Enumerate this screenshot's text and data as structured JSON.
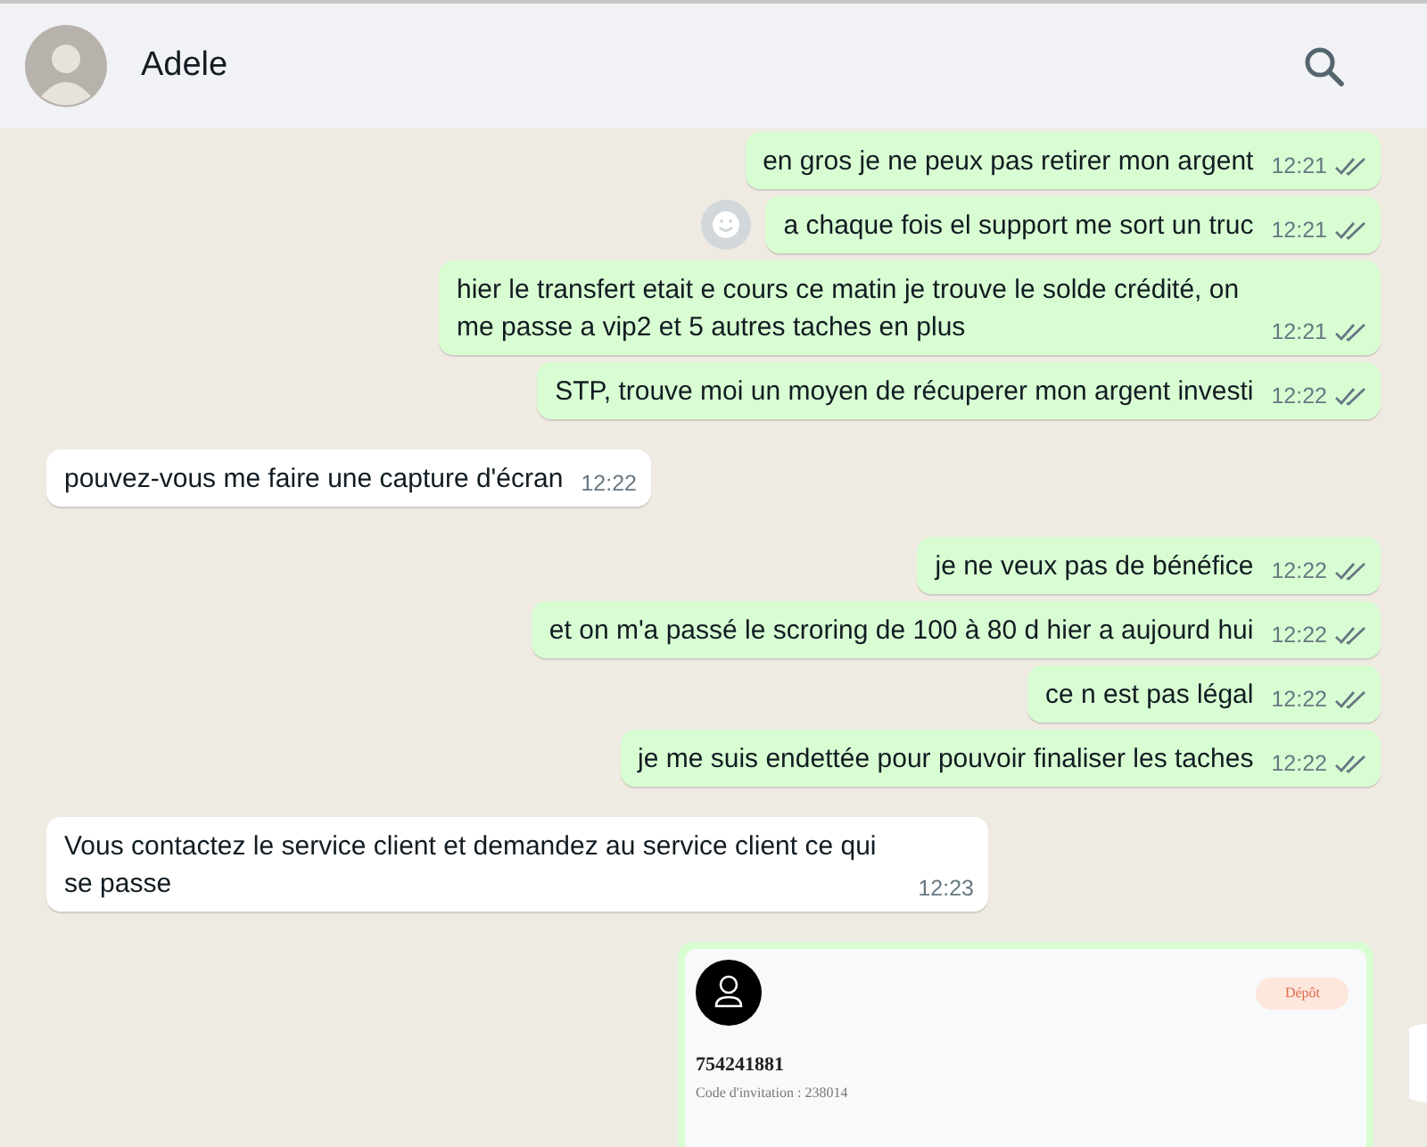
{
  "header": {
    "contact_name": "Adele"
  },
  "messages": [
    {
      "kind": "outgoing",
      "text": "en gros je ne peux pas retirer mon argent",
      "time": "12:21"
    },
    {
      "kind": "outgoing",
      "text": "a chaque fois el support me sort un truc",
      "time": "12:21",
      "reaction_button": true
    },
    {
      "kind": "outgoing",
      "text": "hier le transfert etait e cours ce matin je trouve le solde crédité, on me passe a vip2 et 5 autres taches en plus",
      "time": "12:21"
    },
    {
      "kind": "outgoing",
      "text": "STP, trouve moi un moyen de récuperer mon argent investi",
      "time": "12:22"
    },
    {
      "kind": "incoming",
      "text": "pouvez-vous me faire une capture d'écran",
      "time": "12:22"
    },
    {
      "kind": "outgoing",
      "text": "je ne veux pas de bénéfice",
      "time": "12:22"
    },
    {
      "kind": "outgoing",
      "text": "et on m'a passé le scroring de 100 à 80 d hier a aujourd hui",
      "time": "12:22"
    },
    {
      "kind": "outgoing",
      "text": "ce n est pas légal",
      "time": "12:22"
    },
    {
      "kind": "outgoing",
      "text": "je me suis endettée pour pouvoir finaliser les taches",
      "time": "12:22"
    },
    {
      "kind": "incoming",
      "text": "Vous contactez le service client et demandez au service client ce qui se passe",
      "time": "12:23"
    },
    {
      "kind": "screenshot",
      "account_number": "754241881",
      "invite_code": "Code d'invitation : 238014",
      "badge": "Dépôt"
    }
  ]
}
